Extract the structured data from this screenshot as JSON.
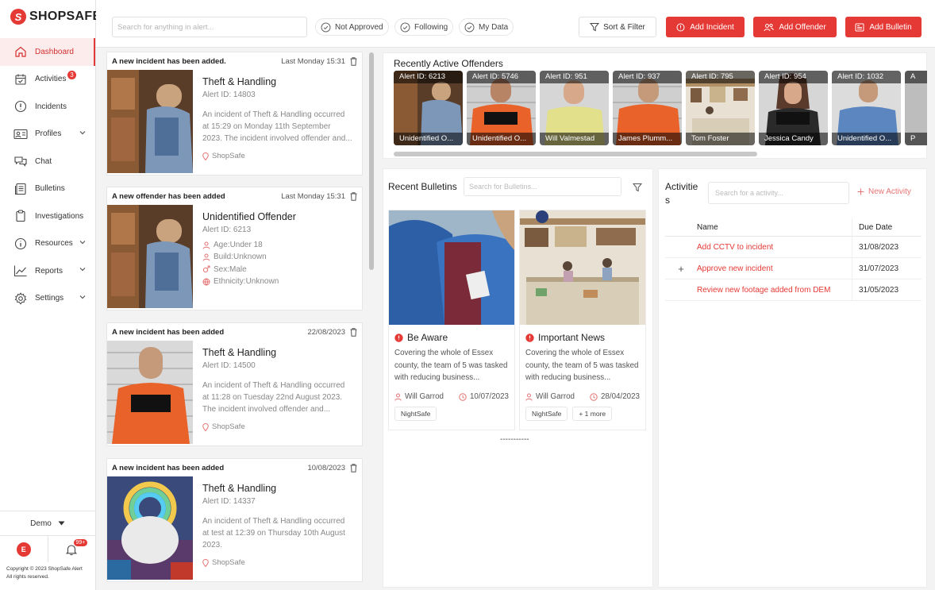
{
  "app": {
    "logo_text": "SHOPSAFE",
    "accent": "#e53935"
  },
  "sidebar": {
    "items": [
      {
        "label": "Dashboard",
        "icon": "home-icon",
        "active": true
      },
      {
        "label": "Activities",
        "icon": "calendar-check-icon",
        "badge": "3"
      },
      {
        "label": "Incidents",
        "icon": "alert-circle-icon"
      },
      {
        "label": "Profiles",
        "icon": "id-card-icon",
        "expandable": true
      },
      {
        "label": "Chat",
        "icon": "chat-icon"
      },
      {
        "label": "Bulletins",
        "icon": "document-icon"
      },
      {
        "label": "Investigations",
        "icon": "clipboard-icon"
      },
      {
        "label": "Resources",
        "icon": "info-icon",
        "expandable": true
      },
      {
        "label": "Reports",
        "icon": "chart-line-icon",
        "expandable": true
      },
      {
        "label": "Settings",
        "icon": "gear-icon",
        "expandable": true
      }
    ],
    "demo_label": "Demo",
    "avatar_letter": "E",
    "notification_count": "99+",
    "copyright": "Copyright © 2023 ShopSafe Alert All rights reserved."
  },
  "topbar": {
    "search_placeholder": "Search for anything in alert...",
    "chips": [
      "Not Approved",
      "Following",
      "My Data"
    ],
    "sort_filter": "Sort & Filter",
    "add_incident": "Add Incident",
    "add_offender": "Add Offender",
    "add_bulletin": "Add Bulletin"
  },
  "feed": [
    {
      "header": "A new incident has been added.",
      "date": "Last Monday 15:31",
      "title": "Theft & Handling",
      "id": "Alert ID: 14803",
      "desc": "An incident of Theft & Handling occurred at 15:29 on Monday 11th September 2023. The incident involved offender and...",
      "location": "ShopSafe"
    },
    {
      "header": "A new offender has been added",
      "date": "Last Monday 15:31",
      "title": "Unidentified Offender",
      "id": "Alert ID: 6213",
      "attrs": [
        "Age:Under 18",
        "Build:Unknown",
        "Sex:Male",
        "Ethnicity:Unknown"
      ]
    },
    {
      "header": "A new incident has been added",
      "date": "22/08/2023",
      "title": "Theft & Handling",
      "id": "Alert ID: 14500",
      "desc": "An incident of Theft & Handling occurred at 11:28 on Tuesday 22nd August 2023. The incident involved offender and...",
      "location": "ShopSafe"
    },
    {
      "header": "A new incident has been added",
      "date": "10/08/2023",
      "title": "Theft & Handling",
      "id": "Alert ID: 14337",
      "desc": "An incident of Theft & Handling occurred at test at 12:39 on Thursday 10th August 2023.",
      "location": "ShopSafe"
    }
  ],
  "offenders": {
    "title": "Recently Active Offenders",
    "items": [
      {
        "id": "Alert ID: 6213",
        "name": "Unidentified O..."
      },
      {
        "id": "Alert ID: 5746",
        "name": "Unidentified O..."
      },
      {
        "id": "Alert ID: 951",
        "name": "Will Valmestad"
      },
      {
        "id": "Alert ID: 937",
        "name": "James Plumm..."
      },
      {
        "id": "Alert ID: 795",
        "name": "Tom Foster"
      },
      {
        "id": "Alert ID: 954",
        "name": "Jessica Candy"
      },
      {
        "id": "Alert ID: 1032",
        "name": "Unidentified O..."
      },
      {
        "id": "A",
        "name": "P"
      }
    ]
  },
  "bulletins": {
    "title": "Recent Bulletins",
    "search_placeholder": "Search for Bulletins...",
    "items": [
      {
        "title": "Be Aware",
        "desc": "Covering the whole of Essex county, the team of 5 was tasked with reducing business...",
        "author": "Will Garrod",
        "date": "10/07/2023",
        "tags": [
          "NightSafe"
        ]
      },
      {
        "title": "Important News",
        "desc": "Covering the whole of Essex county, the team of 5 was tasked with reducing business...",
        "author": "Will Garrod",
        "date": "28/04/2023",
        "tags": [
          "NightSafe",
          "+ 1 more"
        ]
      }
    ],
    "loader": "-----------"
  },
  "activities": {
    "title_a": "Activitie",
    "title_b": "s",
    "search_placeholder": "Search for a activity...",
    "new_label": "New Activity",
    "col_name": "Name",
    "col_due": "Due Date",
    "rows": [
      {
        "name": "Add CCTV to incident",
        "due": "31/08/2023",
        "expand": ""
      },
      {
        "name": "Approve new incident",
        "due": "31/07/2023",
        "expand": "+"
      },
      {
        "name": "Review new footage added from DEM",
        "due": "31/05/2023",
        "expand": ""
      }
    ]
  }
}
